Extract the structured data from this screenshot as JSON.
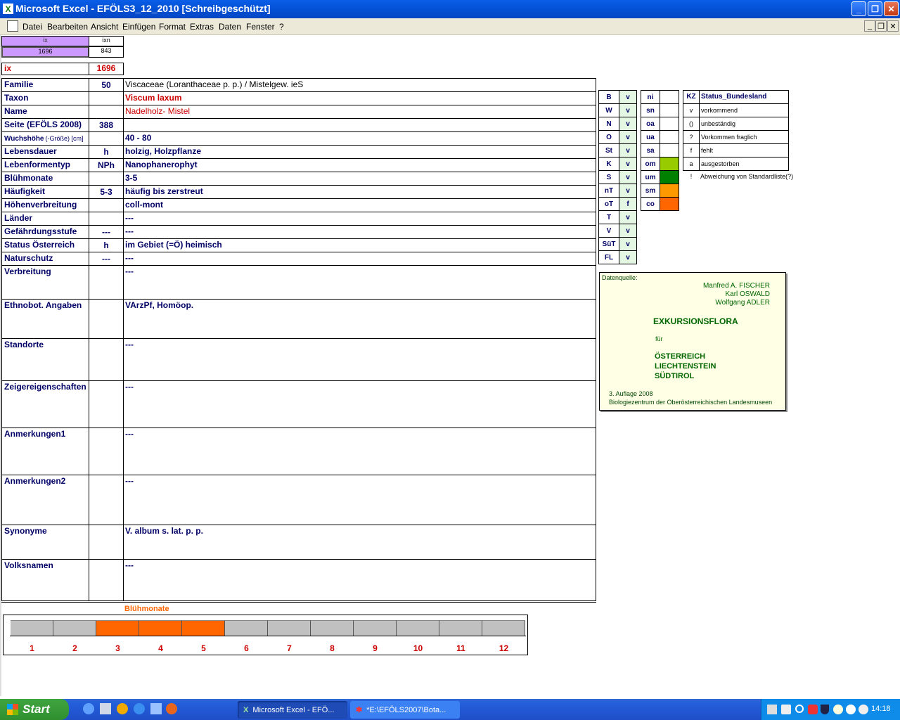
{
  "window": {
    "title": "Microsoft Excel - EFÖLS3_12_2010  [Schreibgeschützt]"
  },
  "menu": [
    "Datei",
    "Bearbeiten",
    "Ansicht",
    "Einfügen",
    "Format",
    "Extras",
    "Daten",
    "Fenster",
    "?"
  ],
  "index": {
    "hdr_ix": "ix",
    "hdr_ixn": "ixn",
    "val_ix": "1696",
    "val_ixn": "843",
    "ix_label": "ix",
    "ix_value": "1696"
  },
  "rows": [
    {
      "label": "Familie",
      "code": "50",
      "text": "Viscaceae (Loranthaceae p. p.)  /  Mistelgew. ieS"
    },
    {
      "label": "Taxon",
      "code": "",
      "text": "Viscum laxum"
    },
    {
      "label": "Name",
      "code": "",
      "text": "Nadelholz- Mistel"
    },
    {
      "label": "Seite (EFÖLS 2008)",
      "code": "388",
      "text": ""
    },
    {
      "label": "Wuchshöhe",
      "label2": "(-Größe) [cm]",
      "code": "",
      "text": " 40 - 80"
    },
    {
      "label": "Lebensdauer",
      "code": "h",
      "text": "holzig, Holzpflanze"
    },
    {
      "label": "Lebenformentyp",
      "code": "NPh",
      "text": "Nanophanerophyt"
    },
    {
      "label": "Blühmonate",
      "code": "",
      "text": " 3-5"
    },
    {
      "label": "Häufigkeit",
      "code": "5-3",
      "text": "häufig bis zerstreut"
    },
    {
      "label": "Höhenverbreitung",
      "code": "",
      "text": "coll-mont"
    },
    {
      "label": "Länder",
      "code": "",
      "text": " ---"
    },
    {
      "label": "Gefährdungsstufe",
      "code": "---",
      "text": "  ---"
    },
    {
      "label": "Status Österreich",
      "code": "h",
      "text": "im Gebiet (=Ö) heimisch"
    },
    {
      "label": "Naturschutz",
      "code": "---",
      "text": " ---"
    },
    {
      "label": "Verbreitung",
      "code": "",
      "text": " ---"
    },
    {
      "label": "Ethnobot. Angaben",
      "code": "",
      "text": "VArzPf, Homöop."
    },
    {
      "label": "Standorte",
      "code": "",
      "text": "---"
    },
    {
      "label": "Zeigereigenschaften",
      "code": "",
      "text": "---"
    },
    {
      "label": "Anmerkungen1",
      "code": "",
      "text": "---"
    },
    {
      "label": "Anmerkungen2",
      "code": "",
      "text": "---"
    },
    {
      "label": "Synonyme",
      "code": "",
      "text": "V. album s. lat. p. p."
    },
    {
      "label": "Volksnamen",
      "code": "",
      "text": "---"
    }
  ],
  "states": [
    {
      "k": "B",
      "v": "v"
    },
    {
      "k": "W",
      "v": "v"
    },
    {
      "k": "N",
      "v": "v"
    },
    {
      "k": "O",
      "v": "v"
    },
    {
      "k": "St",
      "v": "v"
    },
    {
      "k": "K",
      "v": "v"
    },
    {
      "k": "S",
      "v": "v"
    },
    {
      "k": "nT",
      "v": "v"
    },
    {
      "k": "oT",
      "v": "f"
    },
    {
      "k": "T",
      "v": "v"
    },
    {
      "k": "V",
      "v": "v"
    },
    {
      "k": "SüT",
      "v": "v"
    },
    {
      "k": "FL",
      "v": "v"
    }
  ],
  "zones": [
    {
      "k": "ni",
      "color": "#ffffff"
    },
    {
      "k": "sn",
      "color": "#ffffff"
    },
    {
      "k": "oa",
      "color": "#ffffff"
    },
    {
      "k": "ua",
      "color": "#ffffff"
    },
    {
      "k": "sa",
      "color": "#ffffff"
    },
    {
      "k": "om",
      "color": "#99cc00"
    },
    {
      "k": "um",
      "color": "#008000"
    },
    {
      "k": "sm",
      "color": "#ff9900"
    },
    {
      "k": "co",
      "color": "#ff6600"
    }
  ],
  "legend": {
    "hdr_kz": "KZ",
    "hdr_status": "Status_Bundesland",
    "items": [
      {
        "k": "v",
        "t": "vorkommend"
      },
      {
        "k": "()",
        "t": "unbeständig"
      },
      {
        "k": "?",
        "t": "Vorkommen fraglich"
      },
      {
        "k": "f",
        "t": "fehlt"
      },
      {
        "k": "a",
        "t": "ausgestorben"
      },
      {
        "k": "!",
        "t": "Abweichung von Standardliste(?)"
      }
    ]
  },
  "source": {
    "label": "Datenquelle:",
    "authors": [
      "Manfred A. FISCHER",
      "Karl OSWALD",
      "Wolfgang ADLER"
    ],
    "title": "EXKURSIONSFLORA",
    "fuer": "für",
    "countries": [
      "ÖSTERREICH",
      "LIECHTENSTEIN",
      "SÜDTIROL"
    ],
    "edition": "3. Auflage 2008",
    "publisher": "Biologiezentrum der Oberösterreichischen Landesmuseen"
  },
  "bloom": {
    "title": "Blühmonate",
    "months": [
      "1",
      "2",
      "3",
      "4",
      "5",
      "6",
      "7",
      "8",
      "9",
      "10",
      "11",
      "12"
    ],
    "active": [
      false,
      false,
      true,
      true,
      true,
      false,
      false,
      false,
      false,
      false,
      false,
      false
    ],
    "active_color": "#ff6600",
    "inactive_color": "#c0c0c0"
  },
  "taskbar": {
    "start": "Start",
    "tasks": [
      "Microsoft Excel - EFÖ...",
      "*E:\\EFÖLS2007\\Bota..."
    ],
    "clock": "14:18"
  }
}
